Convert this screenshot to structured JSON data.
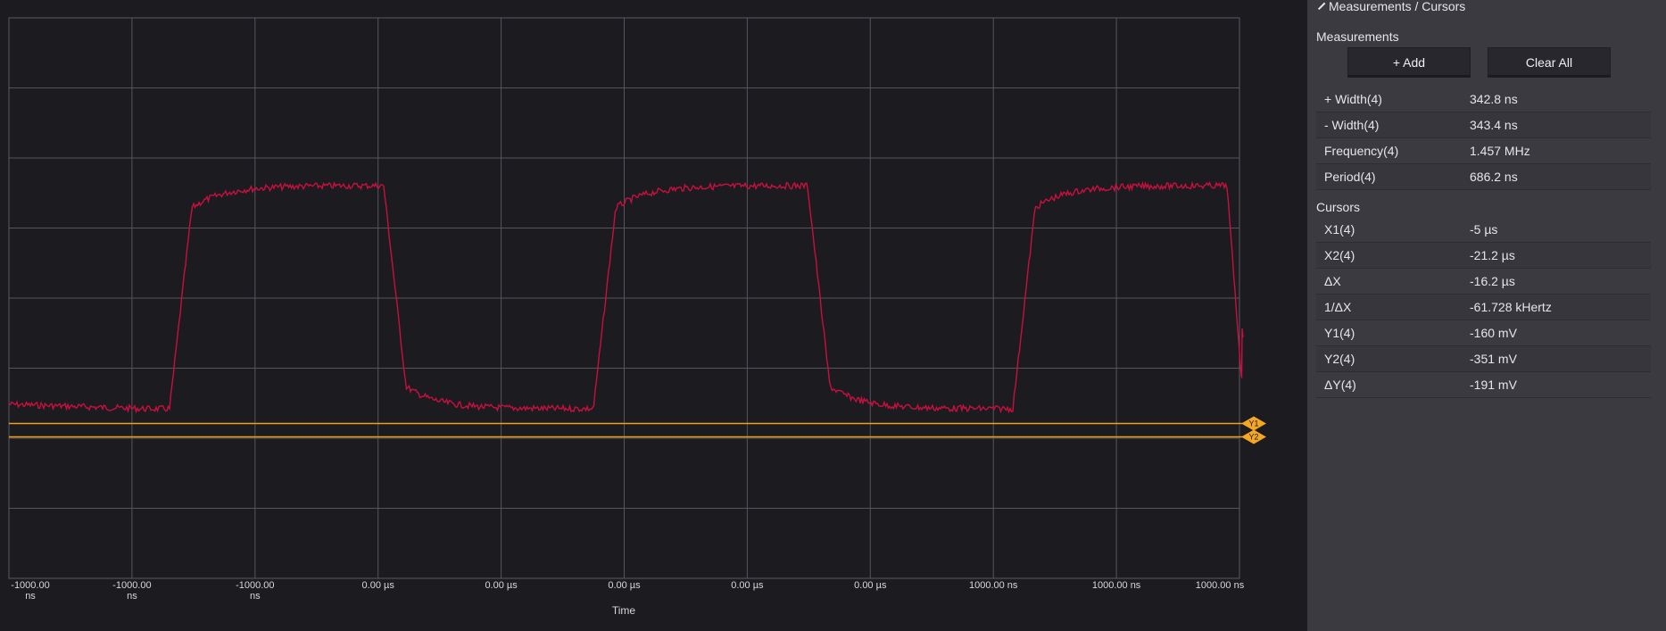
{
  "panel": {
    "title": "Measurements / Cursors",
    "measurements_label": "Measurements",
    "add_button": "+ Add",
    "clear_button": "Clear All",
    "measurements": [
      {
        "label": "+ Width(4)",
        "value": "342.8 ns"
      },
      {
        "label": "- Width(4)",
        "value": "343.4 ns"
      },
      {
        "label": "Frequency(4)",
        "value": "1.457 MHz"
      },
      {
        "label": "Period(4)",
        "value": "686.2 ns"
      }
    ],
    "cursors_label": "Cursors",
    "cursors": [
      {
        "label": "X1(4)",
        "value": "-5 µs"
      },
      {
        "label": "X2(4)",
        "value": "-21.2 µs"
      },
      {
        "label": "ΔX",
        "value": "-16.2 µs"
      },
      {
        "label": "1/ΔX",
        "value": "-61.728 kHertz"
      },
      {
        "label": "Y1(4)",
        "value": "-160 mV"
      },
      {
        "label": "Y2(4)",
        "value": "-351 mV"
      },
      {
        "label": "ΔY(4)",
        "value": "-191 mV"
      }
    ]
  },
  "plot": {
    "x_axis_title": "Time",
    "x_tick_labels": [
      [
        "-1000.00",
        "ns"
      ],
      [
        "-1000.00",
        "ns"
      ],
      [
        "-1000.00",
        "ns"
      ],
      [
        "0.00 µs",
        ""
      ],
      [
        "0.00 µs",
        ""
      ],
      [
        "0.00 µs",
        ""
      ],
      [
        "0.00 µs",
        ""
      ],
      [
        "0.00 µs",
        ""
      ],
      [
        "1000.00 ns",
        ""
      ],
      [
        "1000.00 ns",
        ""
      ],
      [
        "1000.00 ns",
        ""
      ]
    ],
    "cursor_markers": [
      "Y1",
      "Y2"
    ],
    "waveform_color": "#c8103f",
    "cursor_color": "#f5a623"
  }
}
